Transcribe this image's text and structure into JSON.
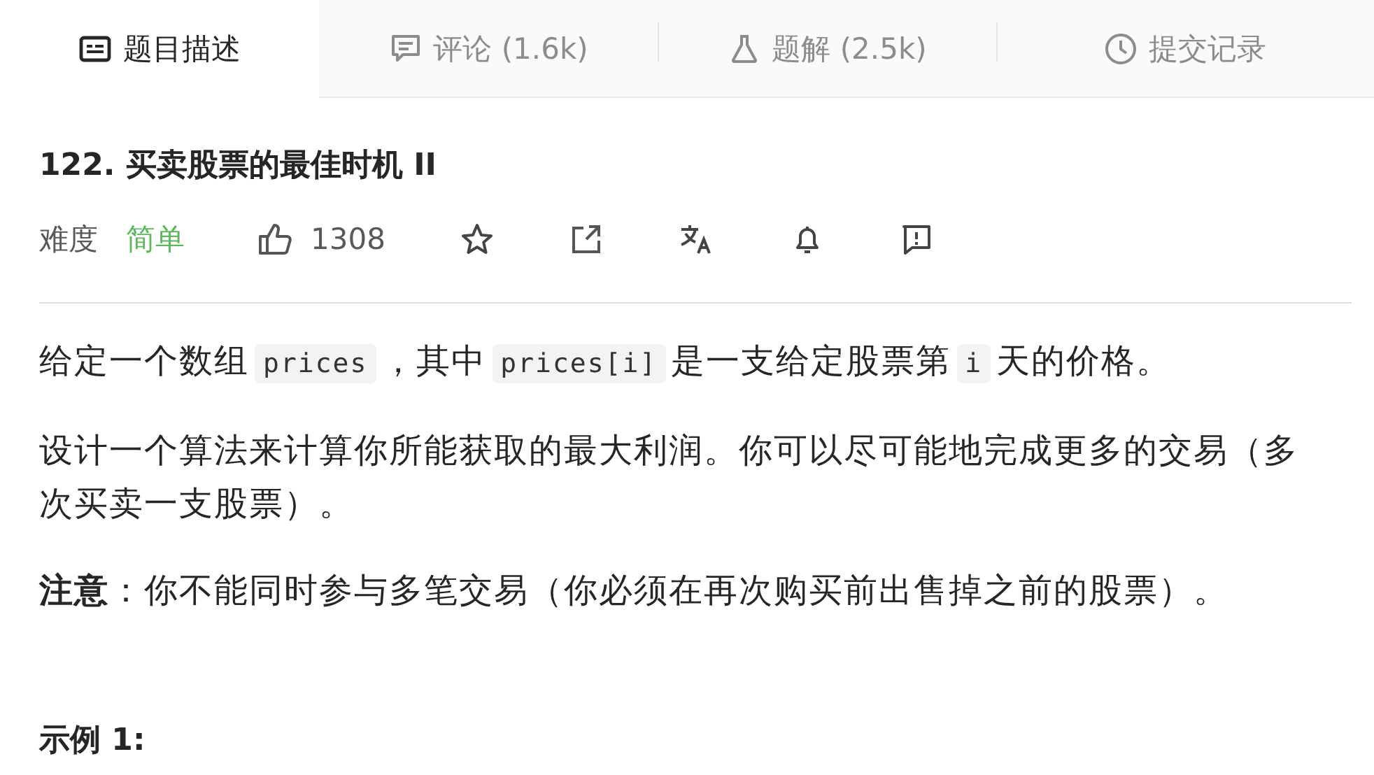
{
  "tabs": [
    {
      "label": "题目描述",
      "kind": "description",
      "selected": true
    },
    {
      "label": "评论 (1.6k)",
      "kind": "comments",
      "selected": false
    },
    {
      "label": "题解 (2.5k)",
      "kind": "solutions",
      "selected": false
    },
    {
      "label": "提交记录",
      "kind": "submissions",
      "selected": false
    }
  ],
  "problem": {
    "title": "122. 买卖股票的最佳时机 II",
    "difficulty_label": "难度",
    "difficulty": "简单",
    "likes": "1308"
  },
  "description": [
    {
      "kind": "segments",
      "segments": [
        {
          "kind": "text",
          "text": "给定一个数组"
        },
        {
          "kind": "code",
          "text": "prices"
        },
        {
          "kind": "text",
          "text": "，其中"
        },
        {
          "kind": "code",
          "text": "prices[i]"
        },
        {
          "kind": "text",
          "text": "是一支给定股票第"
        },
        {
          "kind": "code",
          "text": "i"
        },
        {
          "kind": "text",
          "text": "天的价格。"
        }
      ]
    },
    {
      "kind": "plain",
      "text": "设计一个算法来计算你所能获取的最大利润。你可以尽可能地完成更多的交易（多次买卖一支股票）。"
    },
    {
      "kind": "plain",
      "text": "**注意**：你不能同时参与多笔交易（你必须在再次购买前出售掉之前的股票）。"
    }
  ],
  "example_heading": "示例 1:"
}
